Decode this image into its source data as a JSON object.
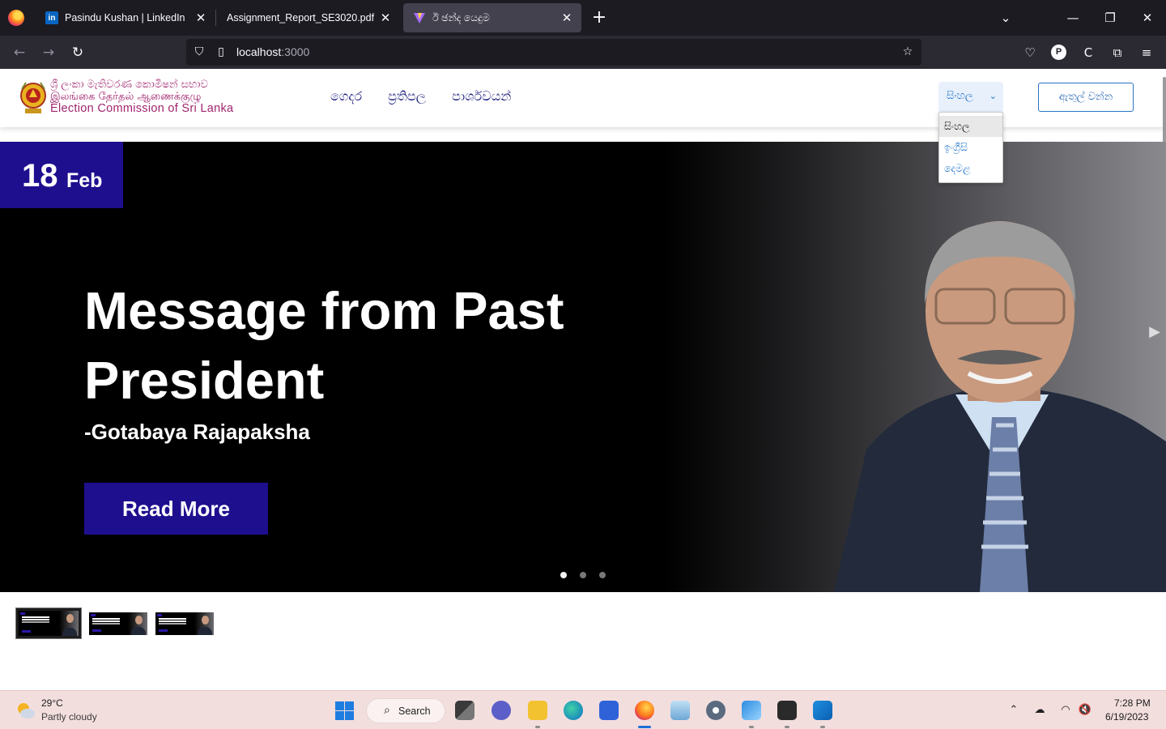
{
  "browser": {
    "tabs": [
      {
        "title": "Pasindu Kushan | LinkedIn",
        "favicon": "linkedin-icon"
      },
      {
        "title": "Assignment_Report_SE3020.pdf",
        "favicon": "pdf-icon"
      },
      {
        "title": "ඊ ඡන්ද යෙදුම",
        "favicon": "vite-icon"
      }
    ],
    "url_host": "localhost",
    "url_port": ":3000"
  },
  "site": {
    "logo": {
      "line1": "ශ්‍රී ලංකා මැතිවරණ කොමිෂන් සභාව",
      "line2": "இலங்கை தேர்தல் ஆணைக்குழு",
      "line3": "Election Commission of Sri Lanka"
    },
    "nav": [
      "ගෙදර",
      "ප්‍රතිපල",
      "පාර්ශවයන්"
    ],
    "language": {
      "selected": "සිංහල",
      "options": [
        "සිංහල",
        "ඉංග්‍රීසි",
        "දෙමළ"
      ]
    },
    "login_label": "ඇතුල් වන්න"
  },
  "hero": {
    "date_day": "18",
    "date_month": "Feb",
    "title": "Message from Past President",
    "subtitle": "-Gotabaya Rajapaksha",
    "cta": "Read More",
    "slides": 3,
    "active_slide": 1
  },
  "thumbnails": {
    "count": 3,
    "selected": 1
  },
  "taskbar": {
    "weather_temp": "29°C",
    "weather_desc": "Partly cloudy",
    "search_label": "Search",
    "time": "7:28 PM",
    "date": "6/19/2023"
  },
  "colors": {
    "brand_navy": "#1e0f8f",
    "link_blue": "#1e73c8",
    "logo_magenta": "#a1246e",
    "nav_text": "#15187a"
  }
}
